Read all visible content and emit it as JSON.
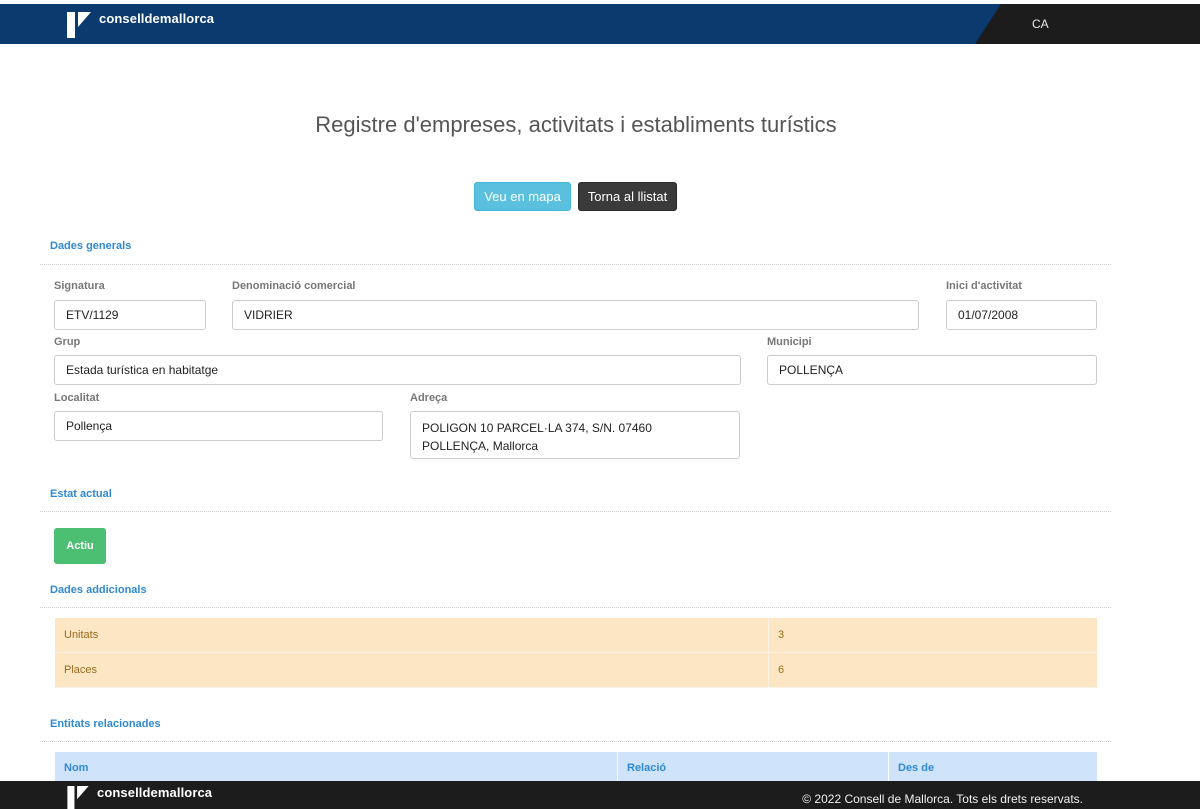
{
  "header": {
    "brand": "conselldemallorca",
    "lang": "CA"
  },
  "page_title": "Registre d'empreses, activitats i establiments turístics",
  "buttons": {
    "map": "Veu en mapa",
    "back": "Torna al llistat"
  },
  "sections": {
    "general": "Dades generals",
    "status": "Estat actual",
    "additional": "Dades addicionals",
    "related": "Entitats relacionades"
  },
  "general": {
    "signatura": {
      "label": "Signatura",
      "value": "ETV/1129"
    },
    "denominacio": {
      "label": "Denominació comercial",
      "value": "VIDRIER"
    },
    "inici": {
      "label": "Inici d'activitat",
      "value": "01/07/2008"
    },
    "grup": {
      "label": "Grup",
      "value": "Estada turística en habitatge"
    },
    "municipi": {
      "label": "Municipi",
      "value": "POLLENÇA"
    },
    "localitat": {
      "label": "Localitat",
      "value": "Pollença"
    },
    "adreca": {
      "label": "Adreça",
      "line1": "POLIGON 10 PARCEL·LA 374, S/N. 07460",
      "line2": "POLLENÇA, Mallorca"
    }
  },
  "status": {
    "badge": "Actiu",
    "color": "#4cbf73"
  },
  "additional": {
    "rows": [
      {
        "label": "Unitats",
        "value": "3"
      },
      {
        "label": "Places",
        "value": "6"
      }
    ]
  },
  "related": {
    "columns": [
      "Nom",
      "Relació",
      "Des de"
    ]
  },
  "footer": {
    "brand": "conselldemallorca",
    "copyright": "© 2022 Consell de Mallorca. Tots els drets reservats."
  },
  "colors": {
    "header_blue": "#0b3a6e",
    "dark": "#1c1c1c",
    "accent": "#2f89d0",
    "info_button": "#5bc0de"
  }
}
